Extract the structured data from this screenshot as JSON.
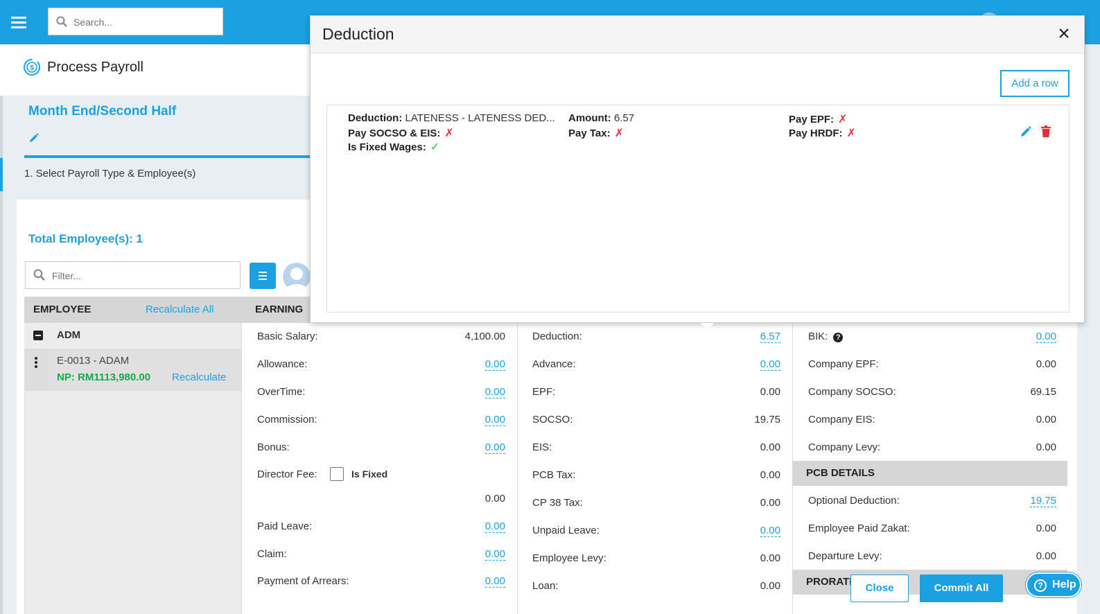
{
  "topbar": {
    "search_placeholder": "Search..."
  },
  "header": {
    "title": "Process Payroll"
  },
  "payroll": {
    "period": "Month End/Second Half",
    "step": "1. Select Payroll Type & Employee(s)",
    "total_employees": "Total Employee(s): 1",
    "filter_placeholder": "Filter..."
  },
  "employee_list": {
    "header": "EMPLOYEE",
    "recalculate_all": "Recalculate All",
    "group": "ADM",
    "employee": {
      "code_name": "E-0013 - ADAM",
      "net_pay": "NP: RM1113,980.00",
      "recalculate": "Recalculate"
    }
  },
  "earning": {
    "header": "EARNING",
    "rows": [
      {
        "label": "Basic Salary:",
        "value": "4,100.00"
      },
      {
        "label": "Allowance:",
        "value": "0.00"
      },
      {
        "label": "OverTime:",
        "value": "0.00"
      },
      {
        "label": "Commission:",
        "value": "0.00"
      },
      {
        "label": "Bonus:",
        "value": "0.00"
      },
      {
        "label": "Director Fee:",
        "value": "0.00",
        "checkbox_label": "Is Fixed"
      },
      {
        "label": "Paid Leave:",
        "value": "0.00"
      },
      {
        "label": "Claim:",
        "value": "0.00"
      },
      {
        "label": "Payment of Arrears:",
        "value": "0.00"
      }
    ]
  },
  "deduction_col": {
    "rows": [
      {
        "label": "Deduction:",
        "value": "6.57"
      },
      {
        "label": "Advance:",
        "value": "0.00"
      },
      {
        "label": "EPF:",
        "value": "0.00"
      },
      {
        "label": "SOCSO:",
        "value": "19.75"
      },
      {
        "label": "EIS:",
        "value": "0.00"
      },
      {
        "label": "PCB Tax:",
        "value": "0.00"
      },
      {
        "label": "CP 38 Tax:",
        "value": "0.00"
      },
      {
        "label": "Unpaid Leave:",
        "value": "0.00"
      },
      {
        "label": "Employee Levy:",
        "value": "0.00"
      },
      {
        "label": "Loan:",
        "value": "0.00"
      }
    ]
  },
  "company_col": {
    "rows": [
      {
        "label": "BIK:",
        "value": "0.00"
      },
      {
        "label": "Company EPF:",
        "value": "0.00"
      },
      {
        "label": "Company SOCSO:",
        "value": "69.15"
      },
      {
        "label": "Company EIS:",
        "value": "0.00"
      },
      {
        "label": "Company Levy:",
        "value": "0.00"
      }
    ],
    "pcb_header": "PCB DETAILS",
    "pcb_rows": [
      {
        "label": "Optional Deduction:",
        "value": "19.75"
      },
      {
        "label": "Employee Paid Zakat:",
        "value": "0.00"
      },
      {
        "label": "Departure Levy:",
        "value": "0.00"
      }
    ],
    "prorate_header": "PRORATE"
  },
  "footer": {
    "close": "Close",
    "commit_all": "Commit All",
    "help": "Help"
  },
  "modal": {
    "title": "Deduction",
    "add_row": "Add a row",
    "entry": {
      "deduction_label": "Deduction:",
      "deduction_value": "LATENESS - LATENESS DED...",
      "amount_label": "Amount:",
      "amount_value": "6.57",
      "pay_epf_label": "Pay EPF:",
      "pay_socso_eis_label": "Pay SOCSO & EIS:",
      "pay_tax_label": "Pay Tax:",
      "pay_hrdf_label": "Pay HRDF:",
      "is_fixed_wages_label": "Is Fixed Wages:",
      "cross_mark": "✗",
      "check_mark": "✓"
    }
  },
  "colors": {
    "accent": "#1ba1e2",
    "net_pay": "#1aa84a",
    "cross": "#e0303a",
    "check": "#1fbf4a",
    "delete": "#e0303a"
  }
}
